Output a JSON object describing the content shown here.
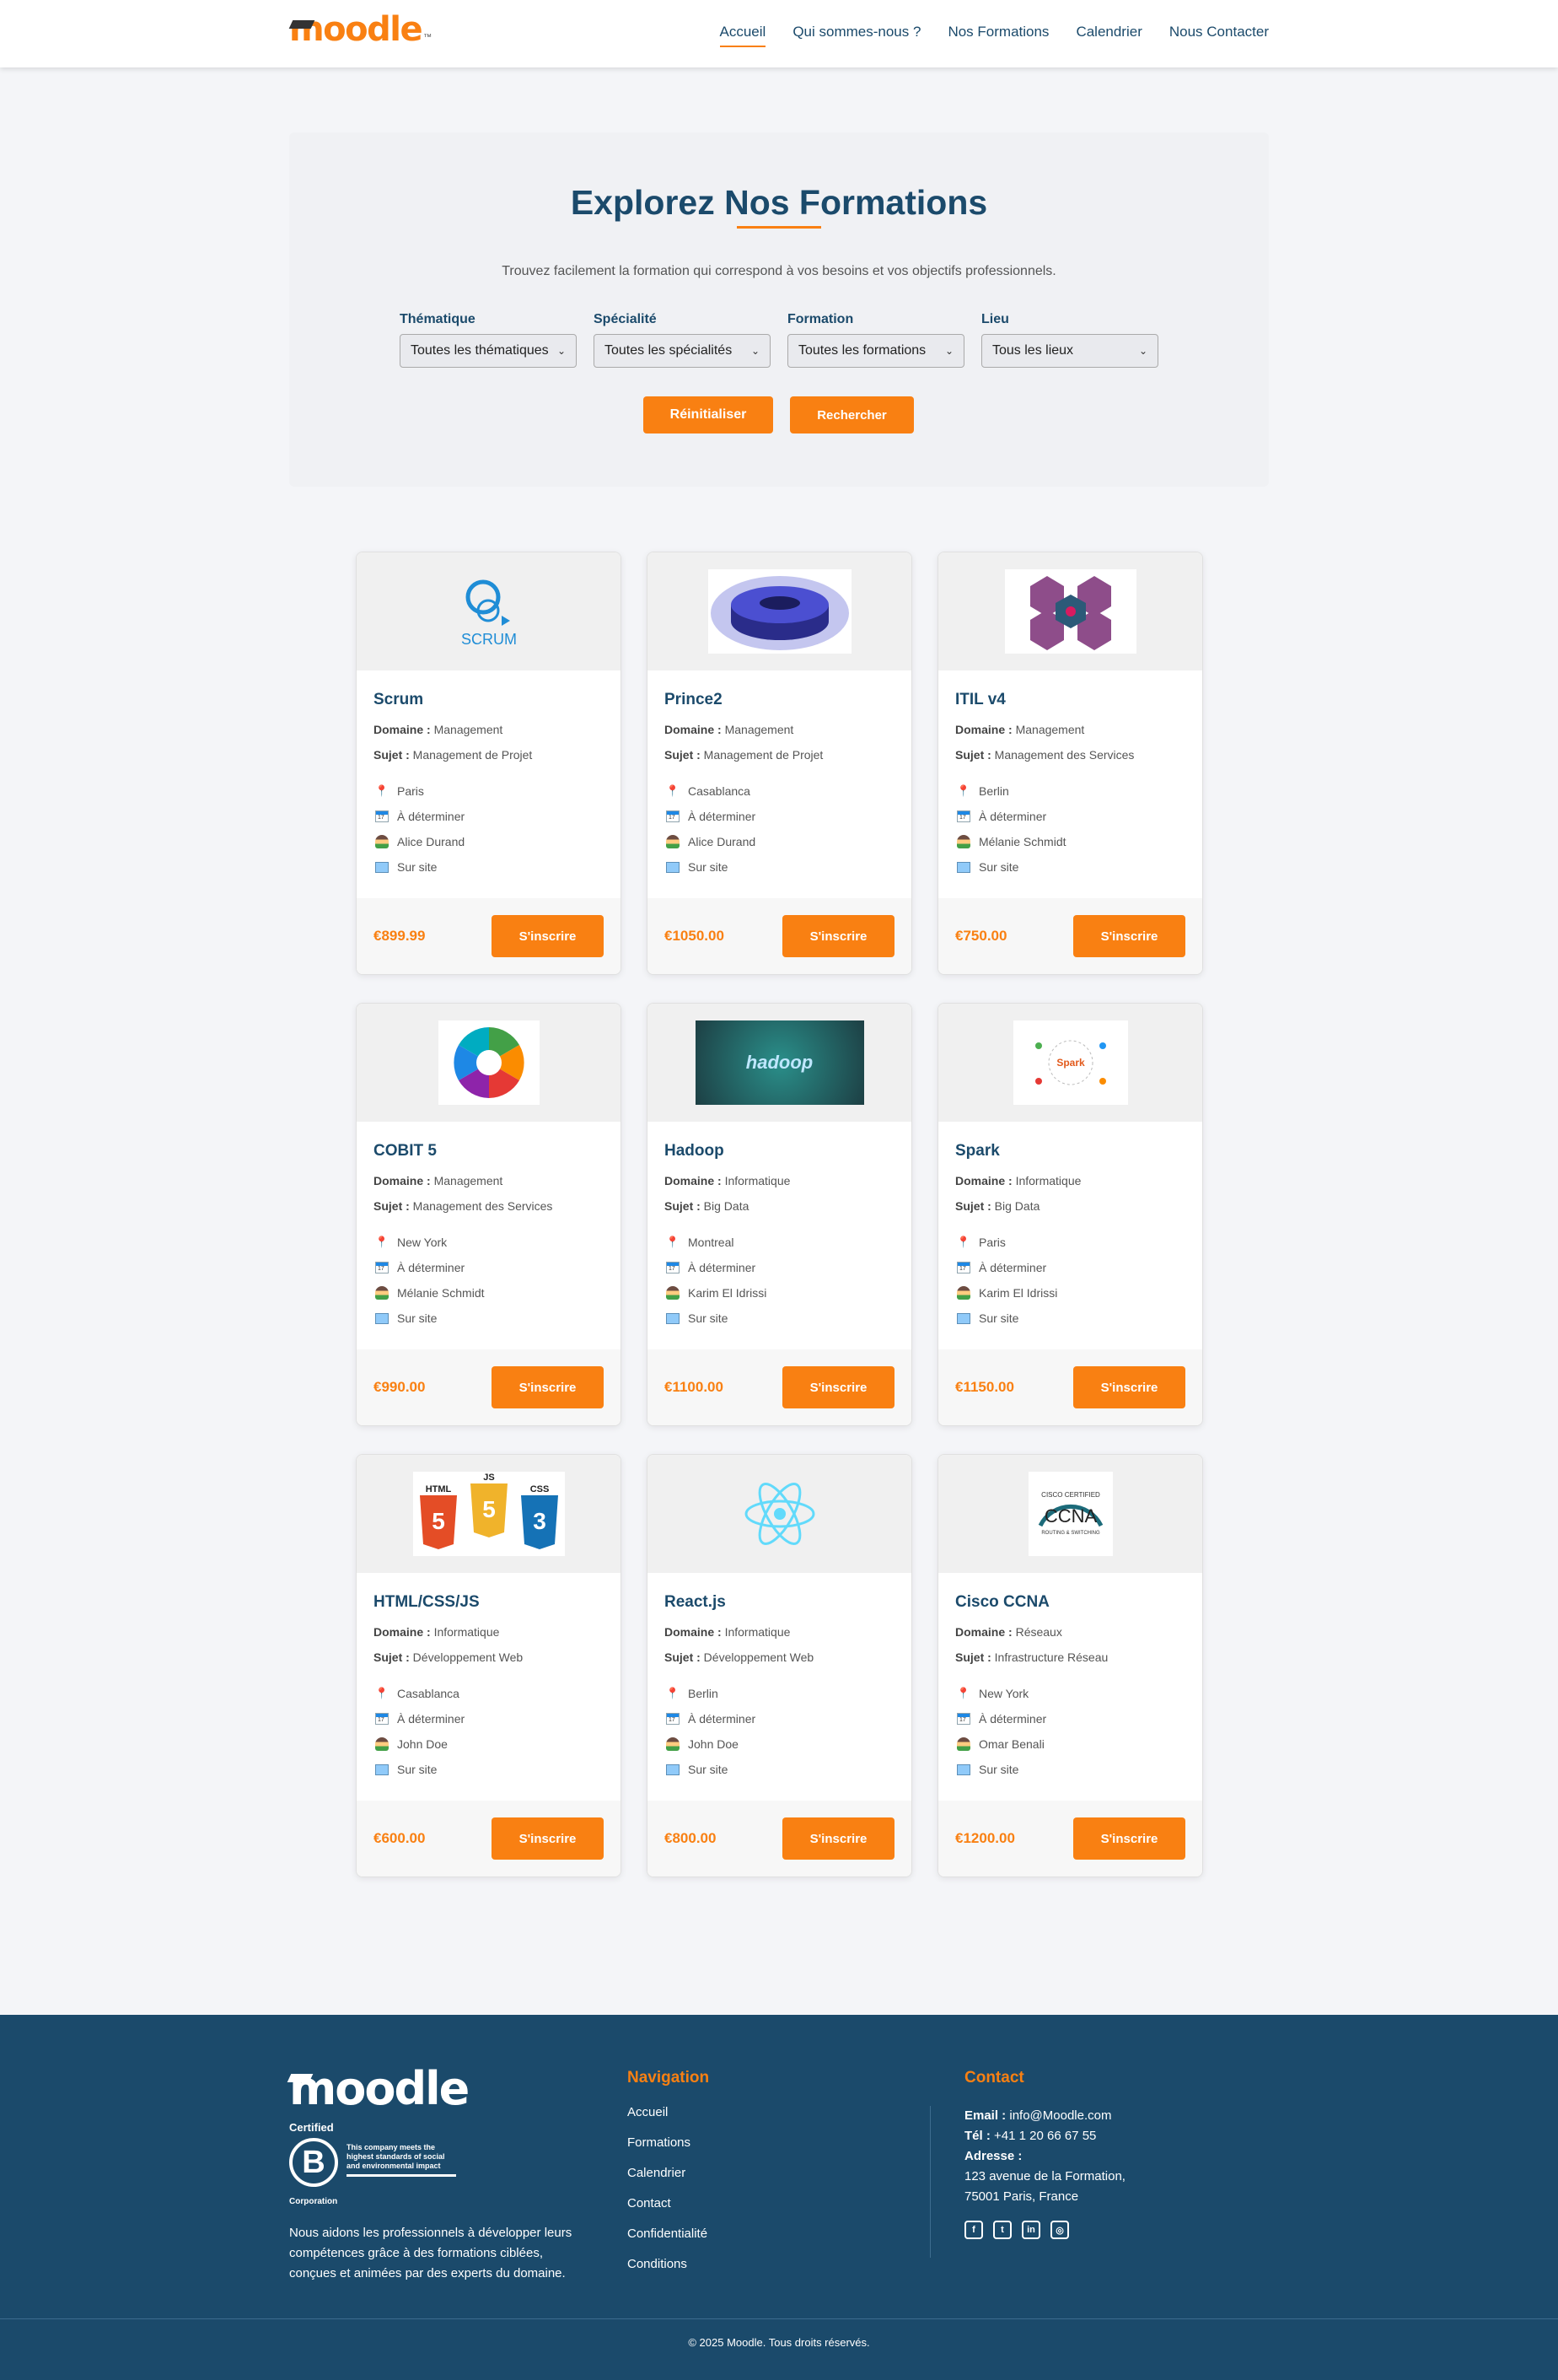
{
  "header": {
    "logo": "moodle",
    "nav": [
      {
        "label": "Accueil",
        "active": true
      },
      {
        "label": "Qui sommes-nous ?",
        "active": false
      },
      {
        "label": "Nos Formations",
        "active": false
      },
      {
        "label": "Calendrier",
        "active": false
      },
      {
        "label": "Nous Contacter",
        "active": false
      }
    ]
  },
  "hero": {
    "title": "Explorez Nos Formations",
    "subtitle": "Trouvez facilement la formation qui correspond à vos besoins et vos objectifs professionnels.",
    "filters": [
      {
        "label": "Thématique",
        "value": "Toutes les thématiques"
      },
      {
        "label": "Spécialité",
        "value": "Toutes les spécialités"
      },
      {
        "label": "Formation",
        "value": "Toutes les formations"
      },
      {
        "label": "Lieu",
        "value": "Tous les lieux"
      }
    ],
    "reset_label": "Réinitialiser",
    "search_label": "Rechercher"
  },
  "labels": {
    "domain": "Domaine :",
    "subject": "Sujet :",
    "enroll": "S'inscrire"
  },
  "courses": [
    {
      "title": "Scrum",
      "domain": "Management",
      "subject": "Management de Projet",
      "location": "Paris",
      "date": "À déterminer",
      "trainer": "Alice Durand",
      "mode": "Sur site",
      "price": "€899.99",
      "image": "scrum-logo",
      "image_text": "SCRUM"
    },
    {
      "title": "Prince2",
      "domain": "Management",
      "subject": "Management de Projet",
      "location": "Casablanca",
      "date": "À déterminer",
      "trainer": "Alice Durand",
      "mode": "Sur site",
      "price": "€1050.00",
      "image": "prince2-diagram",
      "image_text": ""
    },
    {
      "title": "ITIL v4",
      "domain": "Management",
      "subject": "Management des Services",
      "location": "Berlin",
      "date": "À déterminer",
      "trainer": "Mélanie Schmidt",
      "mode": "Sur site",
      "price": "€750.00",
      "image": "itil-diagram",
      "image_text": ""
    },
    {
      "title": "COBIT 5",
      "domain": "Management",
      "subject": "Management des Services",
      "location": "New York",
      "date": "À déterminer",
      "trainer": "Mélanie Schmidt",
      "mode": "Sur site",
      "price": "€990.00",
      "image": "cobit-wheel",
      "image_text": ""
    },
    {
      "title": "Hadoop",
      "domain": "Informatique",
      "subject": "Big Data",
      "location": "Montreal",
      "date": "À déterminer",
      "trainer": "Karim El Idrissi",
      "mode": "Sur site",
      "price": "€1100.00",
      "image": "hadoop-banner",
      "image_text": "hadoop"
    },
    {
      "title": "Spark",
      "domain": "Informatique",
      "subject": "Big Data",
      "location": "Paris",
      "date": "À déterminer",
      "trainer": "Karim El Idrissi",
      "mode": "Sur site",
      "price": "€1150.00",
      "image": "spark-ecosystem",
      "image_text": "Spark"
    },
    {
      "title": "HTML/CSS/JS",
      "domain": "Informatique",
      "subject": "Développement Web",
      "location": "Casablanca",
      "date": "À déterminer",
      "trainer": "John Doe",
      "mode": "Sur site",
      "price": "€600.00",
      "image": "html-css-js-shields",
      "image_text": ""
    },
    {
      "title": "React.js",
      "domain": "Informatique",
      "subject": "Développement Web",
      "location": "Berlin",
      "date": "À déterminer",
      "trainer": "John Doe",
      "mode": "Sur site",
      "price": "€800.00",
      "image": "react-logo",
      "image_text": ""
    },
    {
      "title": "Cisco CCNA",
      "domain": "Réseaux",
      "subject": "Infrastructure Réseau",
      "location": "New York",
      "date": "À déterminer",
      "trainer": "Omar Benali",
      "mode": "Sur site",
      "price": "€1200.00",
      "image": "ccna-badge",
      "image_text": "CCNA"
    }
  ],
  "footer": {
    "logo": "moodle",
    "bcorp": {
      "certified": "Certified",
      "letter": "B",
      "text": "This company meets the highest standards of social and environmental impact",
      "corporation": "Corporation"
    },
    "about": "Nous aidons les professionnels à développer leurs compétences grâce à des formations ciblées, conçues et animées par des experts du domaine.",
    "nav_title": "Navigation",
    "nav_links": [
      "Accueil",
      "Formations",
      "Calendrier",
      "Contact",
      "Confidentialité",
      "Conditions"
    ],
    "contact_title": "Contact",
    "email_label": "Email :",
    "email": "info@Moodle.com",
    "phone_label": "Tél :",
    "phone": "+41 1 20 66 67 55",
    "address_label": "Adresse :",
    "address_line1": "123 avenue de la Formation,",
    "address_line2": "75001 Paris, France",
    "socials": [
      "facebook-icon",
      "twitter-icon",
      "linkedin-icon",
      "instagram-icon"
    ],
    "copyright": "© 2025 Moodle. Tous droits réservés."
  },
  "colors": {
    "primary": "#1b4a6b",
    "accent": "#f98012",
    "background": "#f4f5f8"
  }
}
